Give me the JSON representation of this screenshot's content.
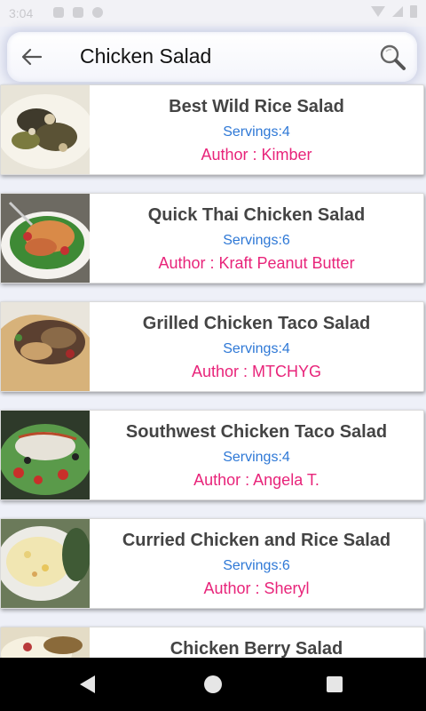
{
  "status_bar": {
    "time": "3:04",
    "icons": [
      "notification-icon-1",
      "notification-icon-2",
      "notification-icon-3",
      "wifi-icon",
      "signal-icon",
      "battery-icon"
    ]
  },
  "search": {
    "query": "Chicken Salad",
    "back_icon": "arrow-left-icon",
    "search_icon": "magnifier-icon"
  },
  "recipes": [
    {
      "title": "Best Wild Rice Salad",
      "servings": "Servings:4",
      "author": "Author : Kimber"
    },
    {
      "title": "Quick Thai Chicken Salad",
      "servings": "Servings:6",
      "author": "Author : Kraft Peanut Butter"
    },
    {
      "title": "Grilled Chicken Taco Salad",
      "servings": "Servings:4",
      "author": "Author : MTCHYG"
    },
    {
      "title": "Southwest Chicken Taco Salad",
      "servings": "Servings:4",
      "author": "Author : Angela T."
    },
    {
      "title": "Curried Chicken and Rice Salad",
      "servings": "Servings:6",
      "author": "Author : Sheryl"
    },
    {
      "title": "Chicken Berry Salad",
      "servings": "",
      "author": ""
    }
  ],
  "colors": {
    "title": "#444444",
    "servings": "#2e78d6",
    "author": "#e8247a",
    "background": "#eef0f8"
  },
  "nav_bar": {
    "buttons": [
      "back-triangle-icon",
      "home-circle-icon",
      "recents-square-icon"
    ]
  }
}
